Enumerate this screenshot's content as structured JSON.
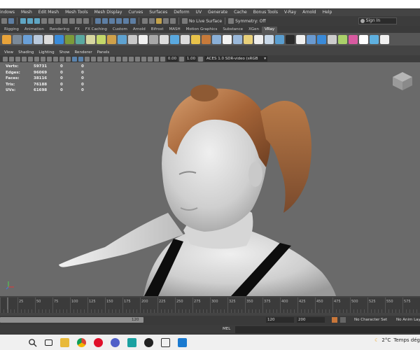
{
  "menubar": {
    "items": [
      "indows",
      "Mesh",
      "Edit Mesh",
      "Mesh Tools",
      "Mesh Display",
      "Curves",
      "Surfaces",
      "Deform",
      "UV",
      "Generate",
      "Cache",
      "Bonus Tools",
      "V-Ray",
      "Arnold",
      "Help"
    ]
  },
  "statusline": {
    "live_surface": "No Live Surface",
    "symmetry": "Symmetry: Off",
    "signin": "Sign In"
  },
  "shelf": {
    "tabs": [
      "Rigging",
      "Animation",
      "Rendering",
      "FX",
      "FX Caching",
      "Custom",
      "Arnold",
      "Bifrost",
      "MASH",
      "Motion Graphics",
      "Substance",
      "XGen",
      "VRay"
    ],
    "active_tab": "VRay",
    "icon_colors": [
      "#e8a33a",
      "#7b8a99",
      "#6aa0d8",
      "#b9c9dc",
      "#dcdcdc",
      "#3a8bd8",
      "#7c9b3a",
      "#5aa9a0",
      "#d7d7a0",
      "#c4d86a",
      "#cfa14a",
      "#5ea2d0",
      "#c8c8c8",
      "#f0f0f0",
      "#a8a8a8",
      "#ddd",
      "#5aa9e0",
      "#dcdcdc",
      "#e8c24a",
      "#c77a3a",
      "#8ab0d8",
      "#f2f2f2",
      "#9ab8da",
      "#e8d07a",
      "#eee",
      "#c8d8e8",
      "#5a9ed0",
      "#2a2a2a",
      "#f0f0f0",
      "#6a9ad0",
      "#3a8ad8",
      "#ccc",
      "#aad06a",
      "#d85aa0",
      "#fff",
      "#5fb0e0",
      "#f0f0f0"
    ]
  },
  "panel": {
    "menus": [
      "View",
      "Shading",
      "Lighting",
      "Show",
      "Renderer",
      "Panels"
    ],
    "exposure": "0.00",
    "gamma": "1.00",
    "colorspace": "ACES 1.0 SDR-video (sRGB"
  },
  "hud": {
    "rows": [
      {
        "label": "Verts:",
        "v1": "59731",
        "v2": "0",
        "v3": "0"
      },
      {
        "label": "Edges:",
        "v1": "96069",
        "v2": "0",
        "v3": "0"
      },
      {
        "label": "Faces:",
        "v1": "38116",
        "v2": "0",
        "v3": "0"
      },
      {
        "label": "Tris:",
        "v1": "76188",
        "v2": "0",
        "v3": "0"
      },
      {
        "label": "UVs:",
        "v1": "61698",
        "v2": "0",
        "v3": "0"
      }
    ]
  },
  "timeline": {
    "ticks": [
      "25",
      "50",
      "75",
      "100",
      "125",
      "150",
      "175",
      "200",
      "225",
      "250",
      "275",
      "300",
      "325",
      "350",
      "375",
      "400",
      "425",
      "450",
      "475",
      "500",
      "525",
      "550",
      "575"
    ]
  },
  "range": {
    "end_label": "120",
    "anim_start": "120",
    "anim_end": "200",
    "character_set": "No Character Set",
    "anim_layer": "No Anim Layer"
  },
  "command": {
    "mel": "MEL"
  },
  "tray": {
    "temp": "2°C",
    "weather": "Temps dég"
  },
  "colors": {
    "viewport_bg": "#6a6a6a",
    "shelf_bg": "#565656",
    "ui_bg": "#444444",
    "accent": "#5285a6"
  }
}
